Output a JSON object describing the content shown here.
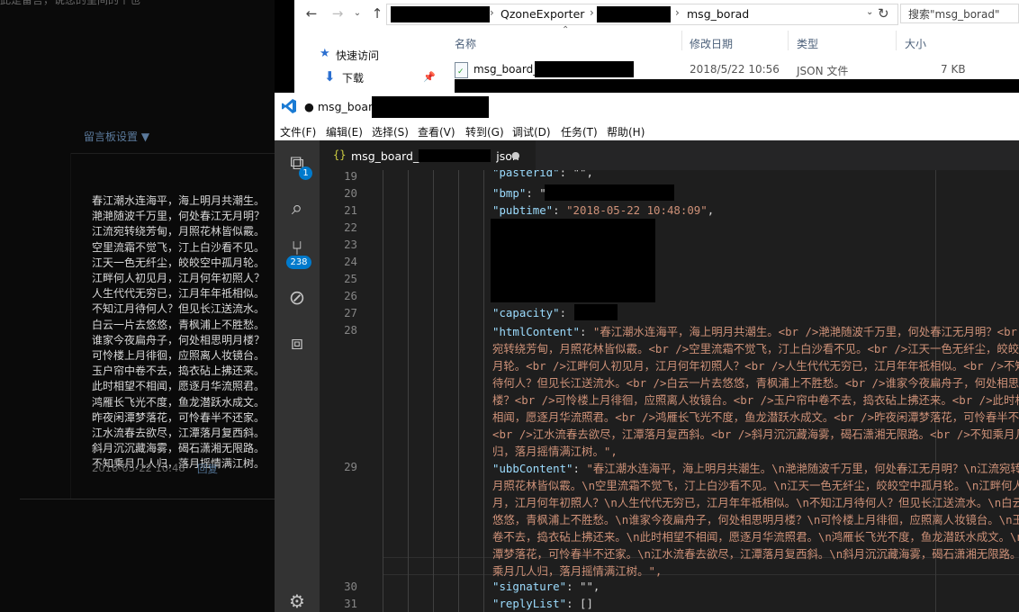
{
  "web": {
    "top_text": "此是留言，说您的呈间的个也",
    "settings_label": "留言板设置 ▼",
    "poem_lines": [
      "春江潮水连海平，海上明月共潮生。",
      "滟滟随波千万里，何处春江无月明？",
      "江流宛转绕芳甸，月照花林皆似霰。",
      "空里流霜不觉飞，汀上白沙看不见。",
      "江天一色无纤尘，皎皎空中孤月轮。",
      "江畔何人初见月，江月何年初照人？",
      "人生代代无穷已，江月年年祗相似。",
      "不知江月待何人？但见长江送流水。",
      "白云一片去悠悠，青枫浦上不胜愁。",
      "谁家今夜扁舟子，何处相思明月楼？",
      "可怜楼上月徘徊，应照离人妆镜台。",
      "玉户帘中卷不去，捣衣砧上拂还来。",
      "此时相望不相闻，愿逐月华流照君。",
      "鸿雁长飞光不度，鱼龙潜跃水成文。",
      "昨夜闲潭梦落花，可怜春半不还家。",
      "江水流春去欲尽，江潭落月复西斜。",
      "斜月沉沉藏海雾，碣石潇湘无限路。",
      "不知乘月几人归，落月摇情满江树。"
    ],
    "time": "2018-05-22 10:48",
    "reply": "回复"
  },
  "explorer": {
    "crumb1": "QzoneExporter",
    "crumb2": "msg_borad",
    "search_placeholder": "搜索\"msg_borad\"",
    "quick_access": "快速访问",
    "downloads": "下载",
    "columns": {
      "name": "名称",
      "modified": "修改日期",
      "type": "类型",
      "size": "大小"
    },
    "file": {
      "name": "msg_board_",
      "modified": "2018/5/22 10:56",
      "type": "JSON 文件",
      "size": "7 KB"
    }
  },
  "vscode": {
    "title": "● msg_board",
    "menu": [
      "文件(F)",
      "编辑(E)",
      "选择(S)",
      "查看(V)",
      "转到(G)",
      "调试(D)",
      "任务(T)",
      "帮助(H)"
    ],
    "explorer_badge": "1",
    "scm_badge": "238",
    "tab_icon": "{}",
    "tab_name": "msg_board_",
    "tab_ext": "json",
    "tab_dirty": "●",
    "line_numbers": [
      "19",
      "20",
      "21",
      "22",
      "23",
      "24",
      "25",
      "26",
      "27",
      "28",
      "29",
      "30",
      "31"
    ],
    "code": {
      "l19_key": "\"pasterid\"",
      "l19_rest": ": \"\",",
      "l20_key": "\"bmp\"",
      "l20_rest": ": \"",
      "l21_key": "\"pubtime\"",
      "l21_colon": ": ",
      "l21_val": "\"2018-05-22 10:48:09\"",
      "l21_comma": ",",
      "l27_key": "\"capacity\"",
      "l27_rest": ":",
      "l28_key": "\"htmlContent\"",
      "l28_colon": ": ",
      "l28_lines": [
        "\"春江潮水连海平，海上明月共潮生。<br  />滟滟随波千万里，何处春江无月明？<br  />江流",
        "宛转绕芳甸，月照花林皆似霰。<br  />空里流霜不觉飞，汀上白沙看不见。<br  />江天一色无纤尘，皎皎空中孤",
        "月轮。<br  />江畔何人初见月，江月何年初照人？<br  />人生代代无穷已，江月年年祗相似。<br  />不知江月",
        "待何人？但见长江送流水。<br  />白云一片去悠悠，青枫浦上不胜愁。<br  />谁家今夜扁舟子，何处相思明月",
        "楼？<br  />可怜楼上月徘徊，应照离人妆镜台。<br  />玉户帘中卷不去，捣衣砧上拂还来。<br  />此时相望不",
        "相闻，愿逐月华流照君。<br  />鸿雁长飞光不度，鱼龙潜跃水成文。<br  />昨夜闲潭梦落花，可怜春半不还家。",
        "<br  />江水流春去欲尽，江潭落月复西斜。<br  />斜月沉沉藏海雾，碣石潇湘无限路。<br  />不知乘月几人",
        "归，落月摇情满江树。\","
      ],
      "l29_key": "\"ubbContent\"",
      "l29_colon": ": ",
      "l29_lines": [
        "\"春江潮水连海平，海上明月共潮生。\\n滟滟随波千万里，何处春江无月明？\\n江流宛转绕芳甸，",
        "月照花林皆似霰。\\n空里流霜不觉飞，汀上白沙看不见。\\n江天一色无纤尘，皎皎空中孤月轮。\\n江畔何人初见",
        "月，江月何年初照人？\\n人生代代无穷已，江月年年祗相似。\\n不知江月待何人？但见长江送流水。\\n白云一片去",
        "悠悠，青枫浦上不胜愁。\\n谁家今夜扁舟子，何处相思明月楼？\\n可怜楼上月徘徊，应照离人妆镜台。\\n玉户帘中",
        "卷不去，捣衣砧上拂还来。\\n此时相望不相闻，愿逐月华流照君。\\n鸿雁长飞光不度，鱼龙潜跃水成文。\\n昨夜闲",
        "潭梦落花，可怜春半不还家。\\n江水流春去欲尽，江潭落月复西斜。\\n斜月沉沉藏海雾，碣石潇湘无限路。\\n不知",
        "乘月几人归，落月摇情满江树。\","
      ],
      "l30_key": "\"signature\"",
      "l30_rest": ": \"\",",
      "l31_key": "\"replyList\"",
      "l31_rest": ": []"
    }
  }
}
